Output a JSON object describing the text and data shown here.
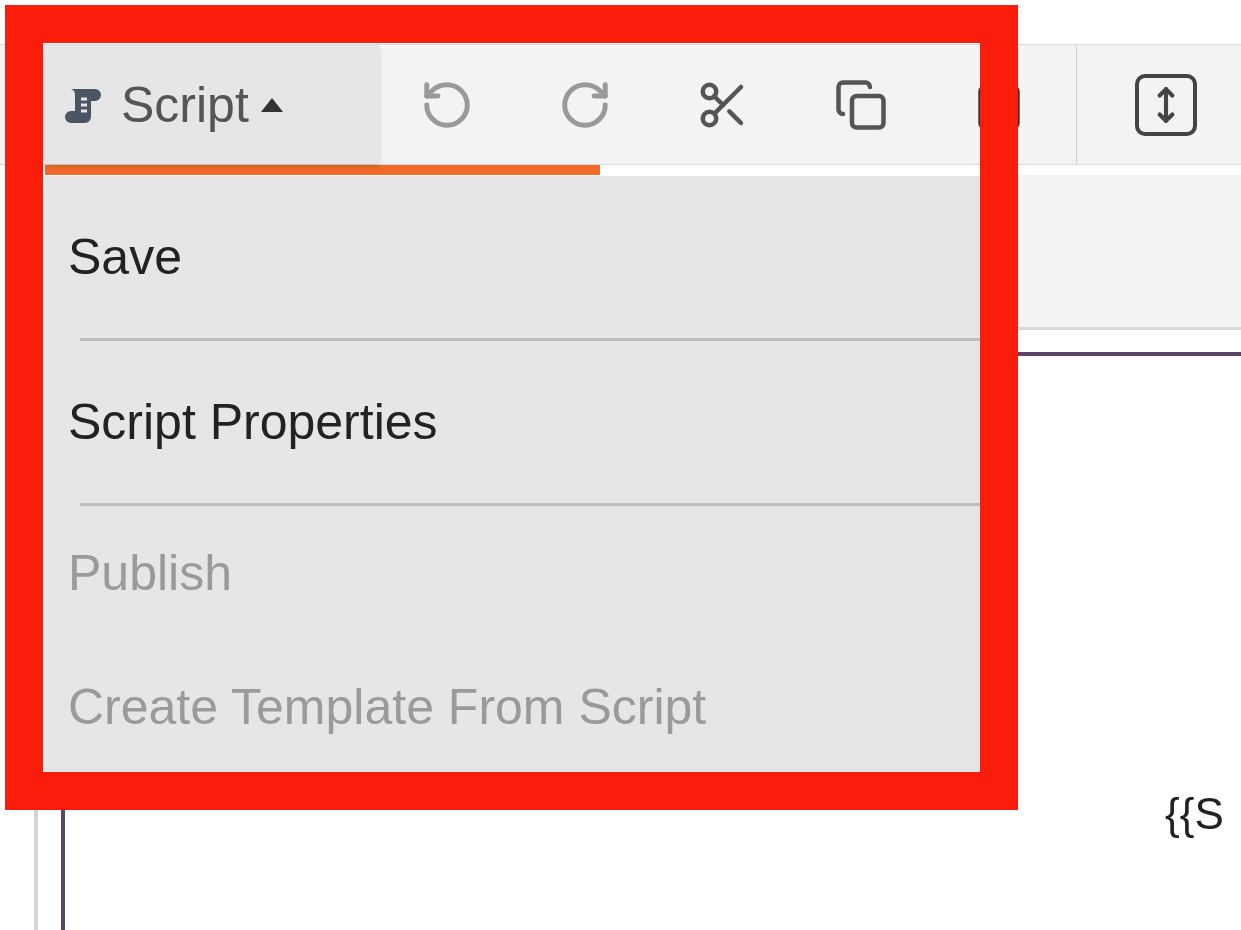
{
  "toolbar": {
    "script_button": {
      "label": "Script",
      "expanded": true
    }
  },
  "menu": {
    "items": [
      {
        "label": "Save",
        "disabled": false,
        "separated": true
      },
      {
        "label": "Script Properties",
        "disabled": false,
        "separated": true
      },
      {
        "label": "Publish",
        "disabled": true,
        "separated": false
      },
      {
        "label": "Create Template From Script",
        "disabled": true,
        "separated": false
      }
    ]
  },
  "content": {
    "snippet": "{{S"
  }
}
